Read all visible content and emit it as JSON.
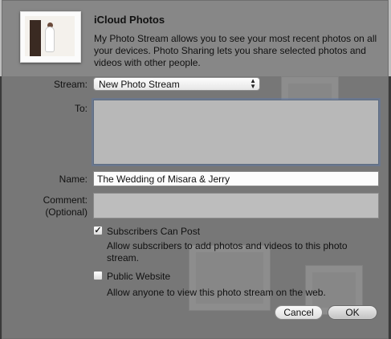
{
  "dialog": {
    "title": "iCloud Photos",
    "description": "My Photo Stream allows you to see your most recent photos on all your devices. Photo Sharing lets you share selected photos and videos with other people."
  },
  "form": {
    "stream_label": "Stream:",
    "stream_value": "New Photo Stream",
    "to_label": "To:",
    "to_value": "",
    "name_label": "Name:",
    "name_value": "The Wedding of Misara & Jerry",
    "comment_label": "Comment:",
    "comment_optional": "(Optional)",
    "comment_value": ""
  },
  "options": {
    "subscribers_can_post": {
      "label": "Subscribers Can Post",
      "checked": true,
      "hint": "Allow subscribers to add photos and videos to this photo stream."
    },
    "public_website": {
      "label": "Public Website",
      "checked": false,
      "hint": "Allow anyone to view this photo stream on the web."
    }
  },
  "buttons": {
    "cancel": "Cancel",
    "ok": "OK"
  },
  "colors": {
    "sheet": "#808080",
    "focus_ring": "#5a78aa"
  },
  "icons": {
    "checkmark": "✓",
    "popup_arrows": "▲▼"
  }
}
